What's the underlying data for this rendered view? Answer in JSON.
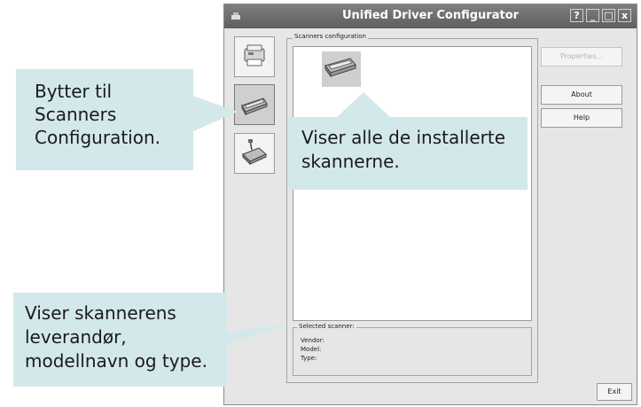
{
  "window": {
    "title": "Unified Driver Configurator",
    "controls": [
      "?",
      "_",
      "□",
      "x"
    ]
  },
  "sidebar": {
    "items": [
      {
        "name": "printers",
        "icon": "printer-icon"
      },
      {
        "name": "scanners",
        "icon": "scanner-icon",
        "active": true
      },
      {
        "name": "ports",
        "icon": "port-icon"
      }
    ]
  },
  "scanners_group": {
    "legend": "Scanners configuration"
  },
  "selected_scanner": {
    "legend": "Selected scanner:",
    "vendor_label": "Vendor:",
    "model_label": "Model:",
    "type_label": "Type:"
  },
  "buttons": {
    "properties": "Properties...",
    "about": "About",
    "help": "Help",
    "exit": "Exit"
  },
  "callouts": {
    "switch_scanners": "Bytter til\nScanners\nConfiguration.",
    "shows_installed": "Viser alle de installerte\nskannerne.",
    "shows_vendor": "Viser skannerens\nleverandør,\nmodellnavn og type."
  },
  "colors": {
    "callout_bg": "#d3e8ea",
    "titlebar": "#6b6b6b",
    "window_bg": "#e6e6e6"
  }
}
